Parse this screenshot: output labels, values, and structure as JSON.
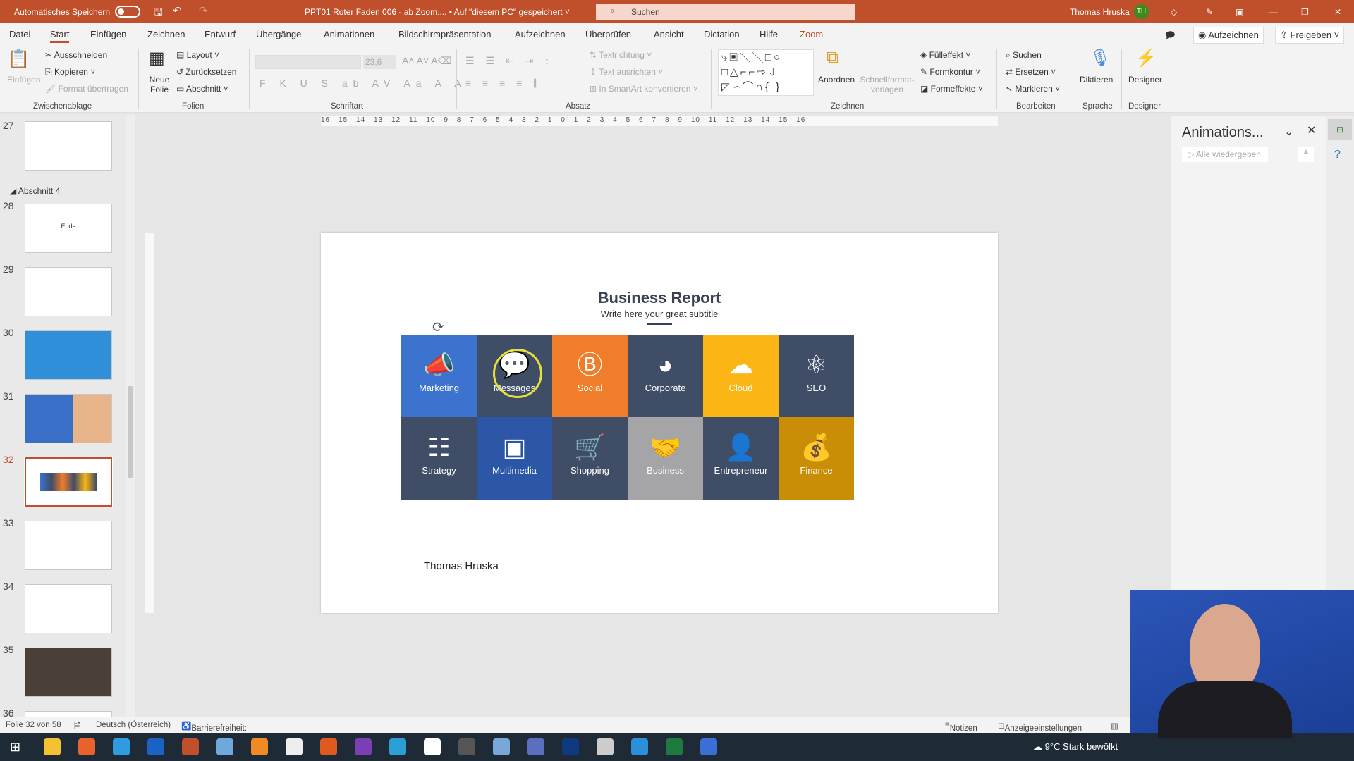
{
  "titlebar": {
    "autosave": "Automatisches Speichern",
    "doc_title": "PPT01 Roter Faden 006 - ab Zoom.... • Auf \"diesem PC\" gespeichert ˅",
    "search": "Suchen",
    "user": "Thomas Hruska",
    "initials": "TH"
  },
  "tabs": [
    "Datei",
    "Start",
    "Einfügen",
    "Zeichnen",
    "Entwurf",
    "Übergänge",
    "Animationen",
    "Bildschirmpräsentation",
    "Aufzeichnen",
    "Überprüfen",
    "Ansicht",
    "Dictation",
    "Hilfe",
    "Zoom"
  ],
  "tab_buttons": {
    "record": "Aufzeichnen",
    "share": "Freigeben"
  },
  "ribbon": {
    "paste": "Einfügen",
    "cut": "Ausschneiden",
    "copy": "Kopieren",
    "format_painter": "Format übertragen",
    "new_slide": "Neue Folie",
    "layout": "Layout",
    "reset": "Zurücksetzen",
    "section": "Abschnitt",
    "font_size": "23,6",
    "text_direction": "Textrichtung",
    "align_text": "Text ausrichten",
    "smartart": "In SmartArt konvertieren",
    "arrange": "Anordnen",
    "quick_styles": "Schnellformat-vorlagen",
    "fill": "Fülleffekt",
    "outline": "Formkontur",
    "effects": "Formeffekte",
    "find": "Suchen",
    "replace": "Ersetzen",
    "select": "Markieren",
    "dictate": "Diktieren",
    "designer": "Designer",
    "groups": [
      "Zwischenablage",
      "Folien",
      "Schriftart",
      "Absatz",
      "Zeichnen",
      "Bearbeiten",
      "Sprache",
      "Designer"
    ]
  },
  "thumbs": {
    "section": "Abschnitt 4",
    "items": [
      {
        "n": "27"
      },
      {
        "n": "28",
        "t": "Ende"
      },
      {
        "n": "29"
      },
      {
        "n": "30"
      },
      {
        "n": "31"
      },
      {
        "n": "32"
      },
      {
        "n": "33"
      },
      {
        "n": "34"
      },
      {
        "n": "35"
      },
      {
        "n": "36"
      }
    ]
  },
  "ruler": "16 · 15 · 14 · 13 · 12 · 11 · 10 · 9 · 8 · 7 · 6 · 5 · 4 · 3 · 2 · 1 · 0 · 1 · 2 · 3 · 4 · 5 · 6 · 7 · 8 · 9 · 10 · 11 · 12 · 13 · 14 · 15 · 16",
  "slide": {
    "title": "Business Report",
    "subtitle": "Write here your great subtitle",
    "author": "Thomas Hruska",
    "tiles": [
      {
        "label": "Marketing",
        "icon": "megaphone-icon",
        "glyph": "📣",
        "color": "#3b73cf"
      },
      {
        "label": "Messages",
        "icon": "chat-icon",
        "glyph": "💬",
        "color": "#3f4d66"
      },
      {
        "label": "Social",
        "icon": "blogger-icon",
        "glyph": "Ⓑ",
        "color": "#f07d2a"
      },
      {
        "label": "Corporate",
        "icon": "pacman-icon",
        "glyph": "◕",
        "color": "#3f4d66"
      },
      {
        "label": "Cloud",
        "icon": "cloud-upload-icon",
        "glyph": "☁",
        "color": "#fbb514"
      },
      {
        "label": "SEO",
        "icon": "atom-icon",
        "glyph": "⚛",
        "color": "#3f4d66"
      },
      {
        "label": "Strategy",
        "icon": "table-icon",
        "glyph": "☷",
        "color": "#3f4d66"
      },
      {
        "label": "Multimedia",
        "icon": "video-icon",
        "glyph": "▣",
        "color": "#2c56a6"
      },
      {
        "label": "Shopping",
        "icon": "cart-icon",
        "glyph": "🛒",
        "color": "#3f4d66"
      },
      {
        "label": "Business",
        "icon": "handshake-icon",
        "glyph": "🤝",
        "color": "#a5a5a7"
      },
      {
        "label": "Entrepreneur",
        "icon": "person-icon",
        "glyph": "👤",
        "color": "#3f4d66"
      },
      {
        "label": "Finance",
        "icon": "money-bag-icon",
        "glyph": "💰",
        "color": "#c98d06"
      }
    ]
  },
  "anim": {
    "title": "Animations...",
    "play_all": "Alle wiedergeben"
  },
  "status": {
    "slide": "Folie 32 von 58",
    "lang": "Deutsch (Österreich)",
    "access": "Barrierefreiheit: Untersuchen",
    "notes": "Notizen",
    "display": "Anzeigeeinstellungen"
  },
  "taskbar": {
    "weather": "9°C  Stark bewölkt"
  },
  "colors": {
    "accent": "#c0502c"
  }
}
